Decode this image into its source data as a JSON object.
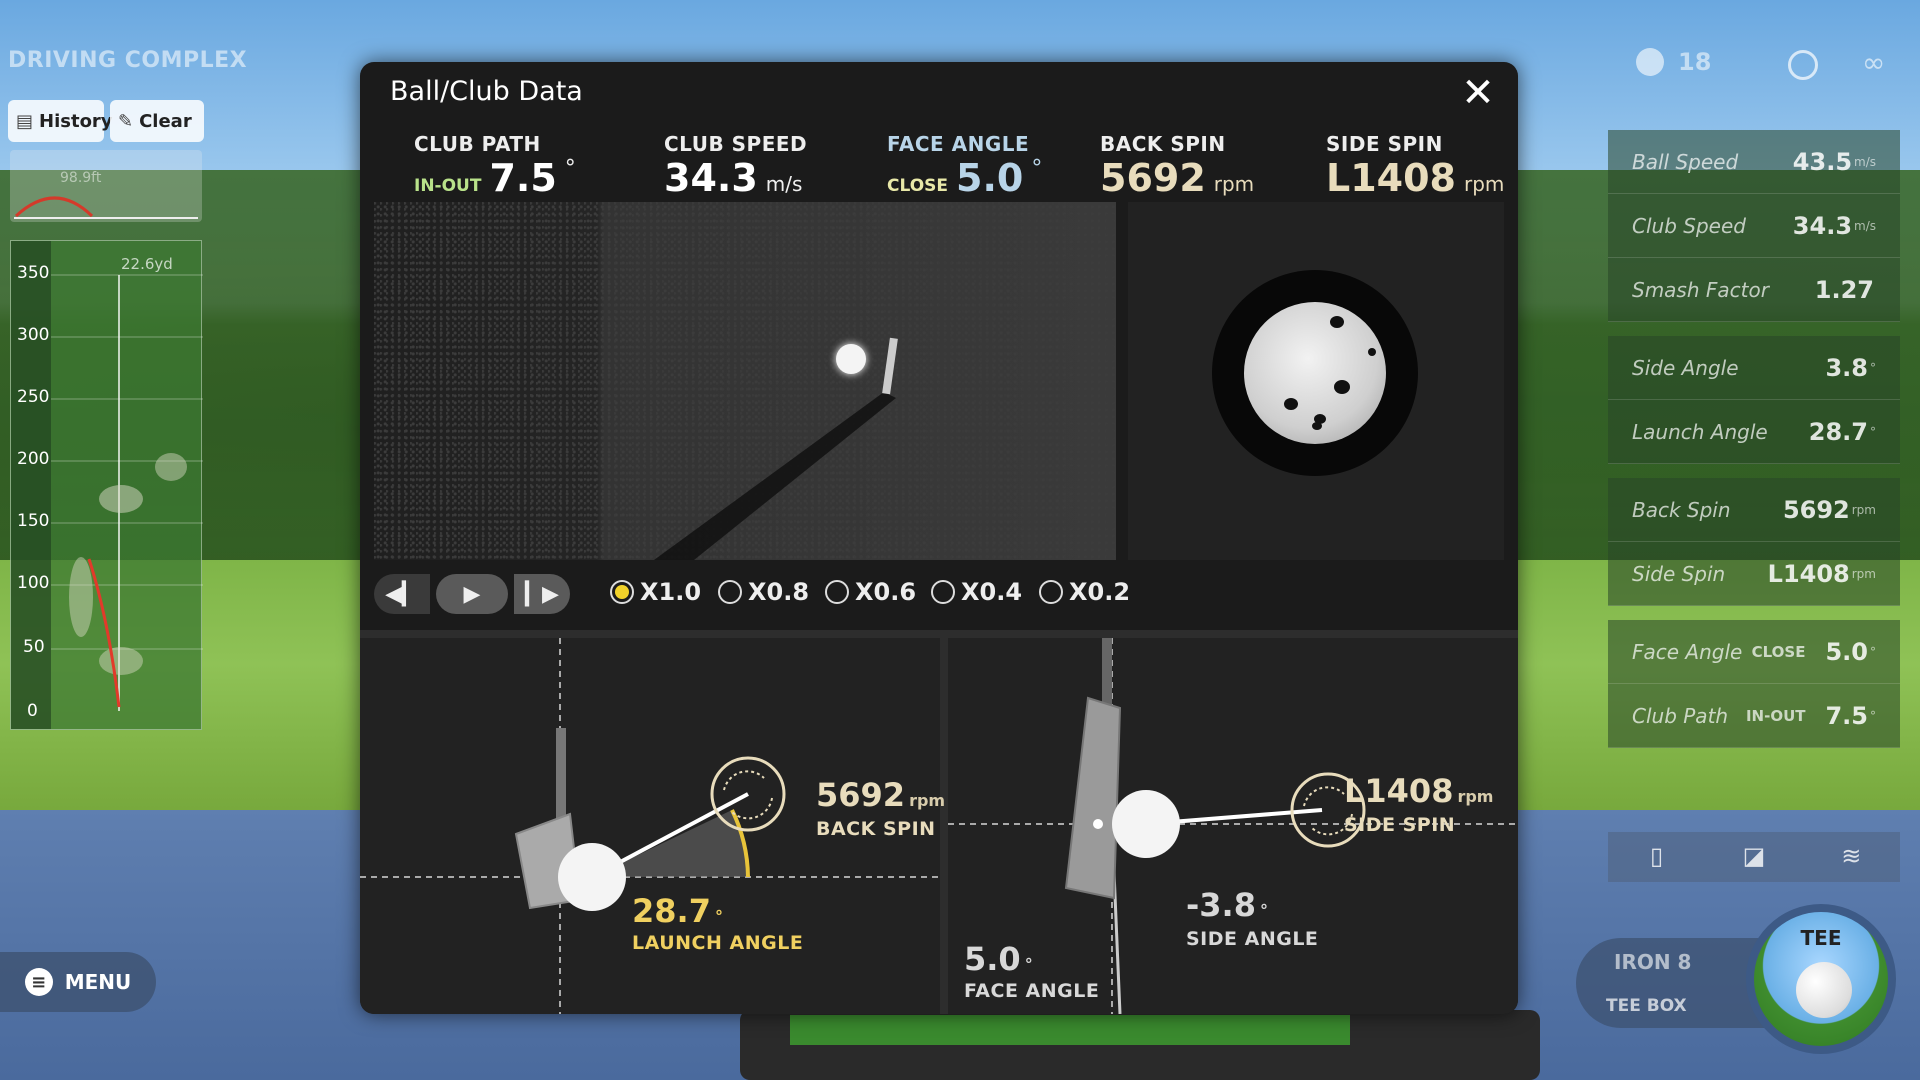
{
  "game": {
    "title": "DRIVING COMPLEX"
  },
  "left_panel": {
    "history_label": "History",
    "clear_label": "Clear",
    "trajectory_distance": "98.9ft",
    "map_top_label": "22.6yd",
    "yard_ticks": [
      "350",
      "300",
      "250",
      "200",
      "150",
      "100",
      "50",
      "0"
    ],
    "menu_label": "MENU"
  },
  "right_panel": {
    "balls_remaining": "18",
    "infinity": "∞",
    "stats": [
      {
        "label": "Ball Speed",
        "value": "43.5",
        "unit": "m/s"
      },
      {
        "label": "Club Speed",
        "value": "34.3",
        "unit": "m/s"
      },
      {
        "label": "Smash Factor",
        "value": "1.27",
        "unit": ""
      },
      {
        "label": "Side Angle",
        "value": "3.8",
        "unit": "°"
      },
      {
        "label": "Launch Angle",
        "value": "28.7",
        "unit": "°"
      },
      {
        "label": "Back Spin",
        "value": "5692",
        "unit": "rpm"
      },
      {
        "label": "Side Spin",
        "value": "L1408",
        "unit": "rpm"
      },
      {
        "label": "Face Angle",
        "extra": "CLOSE",
        "value": "5.0",
        "unit": "°"
      },
      {
        "label": "Club Path",
        "extra": "IN-OUT",
        "value": "7.5",
        "unit": "°"
      }
    ],
    "club": "IRON 8",
    "tee_box": "TEE BOX",
    "tee_label": "TEE"
  },
  "modal": {
    "title": "Ball/Club Data",
    "close_icon": "✕",
    "metrics": {
      "club_path": {
        "name": "CLUB PATH",
        "dir": "IN-OUT",
        "value": "7.5",
        "unit": "°"
      },
      "club_speed": {
        "name": "CLUB SPEED",
        "value": "34.3",
        "unit": "m/s"
      },
      "face_angle": {
        "name": "FACE ANGLE",
        "dir": "CLOSE",
        "value": "5.0",
        "unit": "°"
      },
      "back_spin": {
        "name": "BACK SPIN",
        "value": "5692",
        "unit": "rpm"
      },
      "side_spin": {
        "name": "SIDE SPIN",
        "value": "L1408",
        "unit": "rpm"
      }
    },
    "playback": {
      "speeds": [
        "X1.0",
        "X0.8",
        "X0.6",
        "X0.4",
        "X0.2"
      ],
      "selected": "X1.0"
    },
    "diagram_left": {
      "back_spin_value": "5692",
      "back_spin_unit": "rpm",
      "back_spin_name": "BACK SPIN",
      "launch_angle_value": "28.7",
      "launch_angle_unit": "°",
      "launch_angle_name": "LAUNCH ANGLE"
    },
    "diagram_right": {
      "side_spin_value": "L1408",
      "side_spin_unit": "rpm",
      "side_spin_name": "SIDE SPIN",
      "side_angle_value": "-3.8",
      "side_angle_unit": "°",
      "side_angle_name": "SIDE ANGLE",
      "face_angle_value": "5.0",
      "face_angle_unit": "°",
      "face_angle_name": "FACE ANGLE"
    }
  }
}
